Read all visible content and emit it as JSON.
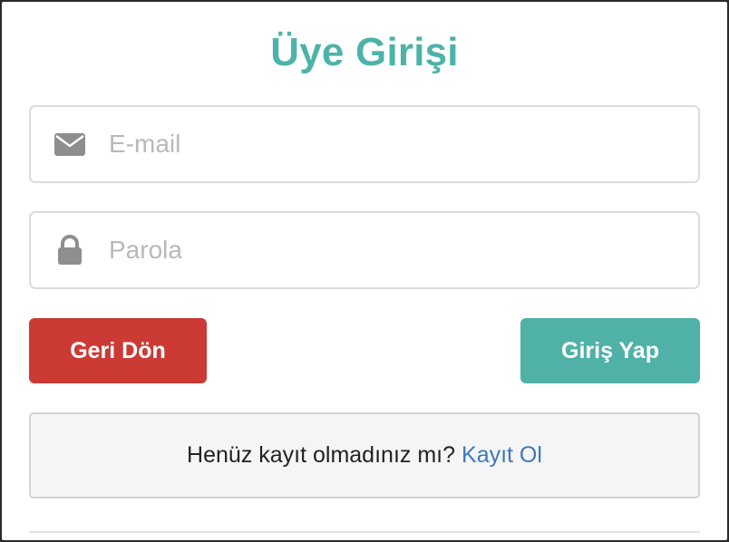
{
  "modal": {
    "title": "Üye Girişi"
  },
  "form": {
    "email": {
      "placeholder": "E-mail",
      "value": "",
      "icon": "envelope-icon"
    },
    "password": {
      "placeholder": "Parola",
      "value": "",
      "icon": "lock-icon"
    }
  },
  "buttons": {
    "back_label": "Geri Dön",
    "login_label": "Giriş Yap"
  },
  "register": {
    "prompt": "Henüz kayıt olmadınız mı?",
    "link_label": "Kayıt Ol"
  },
  "colors": {
    "title": "#4db3a9",
    "back_button": "#cc3a35",
    "login_button": "#50b1a7",
    "link": "#3d78bd"
  }
}
